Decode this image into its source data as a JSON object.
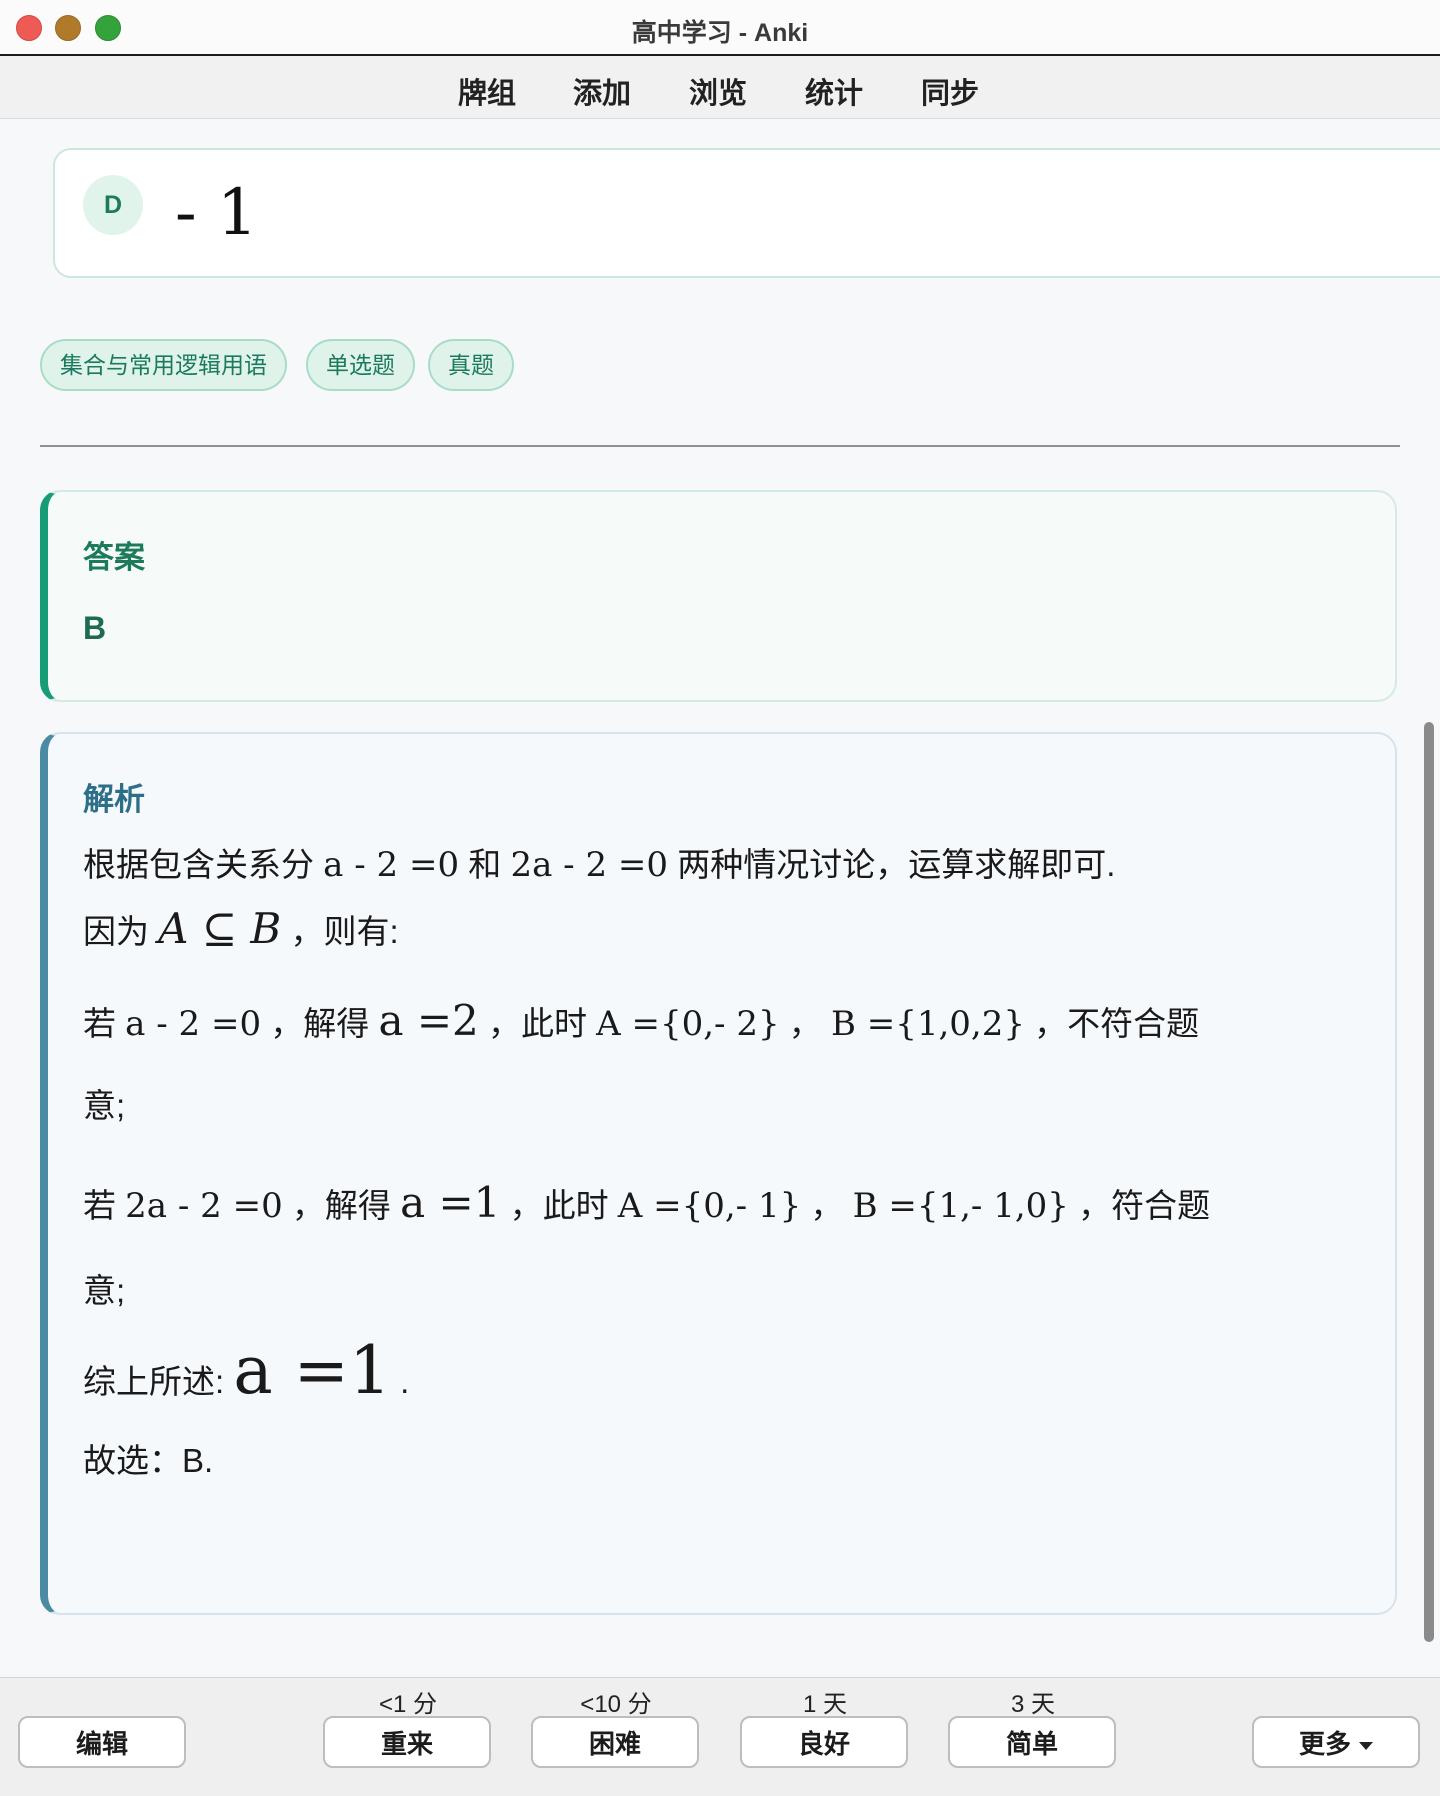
{
  "window": {
    "title": "高中学习 - Anki"
  },
  "toolbar": {
    "items": [
      "牌组",
      "添加",
      "浏览",
      "统计",
      "同步"
    ]
  },
  "card": {
    "option": {
      "letter": "D",
      "text": "- 1"
    },
    "tags": [
      "集合与常用逻辑用语",
      "单选题",
      "真题"
    ],
    "answer": {
      "title": "答案",
      "value": "B"
    },
    "analysis": {
      "title": "解析",
      "l1": {
        "a": "根据包含关系分",
        "m1": "a - 2 =0",
        "b": "和",
        "m2": "2a - 2 =0",
        "c": "两种情况讨论，运算求解即可."
      },
      "l2": {
        "a": "因为",
        "m1": "A ⊆ B",
        "b": "，则有:"
      },
      "l3": {
        "a": "若",
        "m1": "a - 2 =0",
        "b": "，解得",
        "m2": "a =2",
        "c": "，此时",
        "m3": "A ={0,- 2}",
        "d": "，",
        "m4": "B ={1,0,2}",
        "e": "，不符合题"
      },
      "l3b": "意;",
      "l4": {
        "a": "若",
        "m1": "2a - 2 =0",
        "b": "，解得",
        "m2": "a =1",
        "c": "，此时",
        "m3": "A ={0,- 1}",
        "d": "，",
        "m4": "B ={1,- 1,0}",
        "e": "，符合题"
      },
      "l4b": "意;",
      "l5": {
        "a": "综上所述:",
        "m1": "a =1",
        "b": "."
      },
      "l6": "故选：B."
    }
  },
  "bottom": {
    "edit": "编辑",
    "more": "更多",
    "answers": [
      {
        "interval": "<1 分",
        "label": "重来"
      },
      {
        "interval": "<10 分",
        "label": "困难"
      },
      {
        "interval": "1 天",
        "label": "良好"
      },
      {
        "interval": "3 天",
        "label": "简单"
      }
    ]
  },
  "colors": {
    "accent_green": "#179c78",
    "accent_blue": "#4b8aa3",
    "tag_bg": "#e0f3eb"
  }
}
